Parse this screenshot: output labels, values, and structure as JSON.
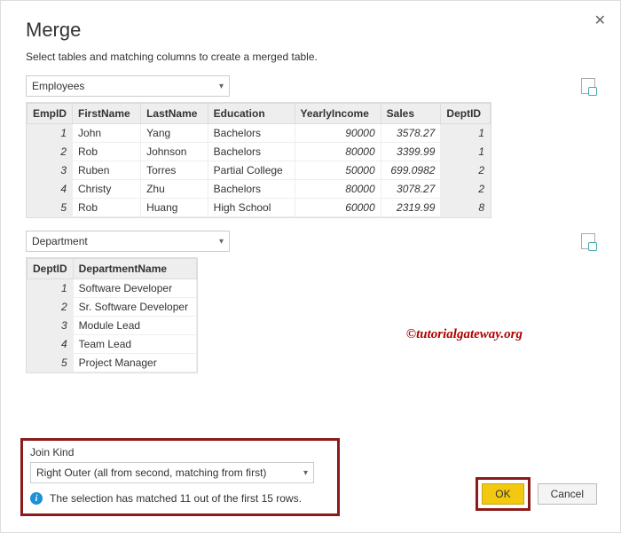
{
  "title": "Merge",
  "subtitle": "Select tables and matching columns to create a merged table.",
  "table1": {
    "selected": "Employees",
    "columns": [
      "EmpID",
      "FirstName",
      "LastName",
      "Education",
      "YearlyIncome",
      "Sales",
      "DeptID"
    ],
    "rows": [
      {
        "EmpID": "1",
        "FirstName": "John",
        "LastName": "Yang",
        "Education": "Bachelors",
        "YearlyIncome": "90000",
        "Sales": "3578.27",
        "DeptID": "1"
      },
      {
        "EmpID": "2",
        "FirstName": "Rob",
        "LastName": "Johnson",
        "Education": "Bachelors",
        "YearlyIncome": "80000",
        "Sales": "3399.99",
        "DeptID": "1"
      },
      {
        "EmpID": "3",
        "FirstName": "Ruben",
        "LastName": "Torres",
        "Education": "Partial College",
        "YearlyIncome": "50000",
        "Sales": "699.0982",
        "DeptID": "2"
      },
      {
        "EmpID": "4",
        "FirstName": "Christy",
        "LastName": "Zhu",
        "Education": "Bachelors",
        "YearlyIncome": "80000",
        "Sales": "3078.27",
        "DeptID": "2"
      },
      {
        "EmpID": "5",
        "FirstName": "Rob",
        "LastName": "Huang",
        "Education": "High School",
        "YearlyIncome": "60000",
        "Sales": "2319.99",
        "DeptID": "8"
      }
    ]
  },
  "table2": {
    "selected": "Department",
    "columns": [
      "DeptID",
      "DepartmentName"
    ],
    "rows": [
      {
        "DeptID": "1",
        "DepartmentName": "Software Developer"
      },
      {
        "DeptID": "2",
        "DepartmentName": "Sr. Software Developer"
      },
      {
        "DeptID": "3",
        "DepartmentName": "Module Lead"
      },
      {
        "DeptID": "4",
        "DepartmentName": "Team Lead"
      },
      {
        "DeptID": "5",
        "DepartmentName": "Project Manager"
      }
    ]
  },
  "joinKind": {
    "label": "Join Kind",
    "selected": "Right Outer (all from second, matching from first)"
  },
  "infoMessage": "The selection has matched 11 out of the first 15 rows.",
  "buttons": {
    "ok": "OK",
    "cancel": "Cancel"
  },
  "watermark": "©tutorialgateway.org"
}
